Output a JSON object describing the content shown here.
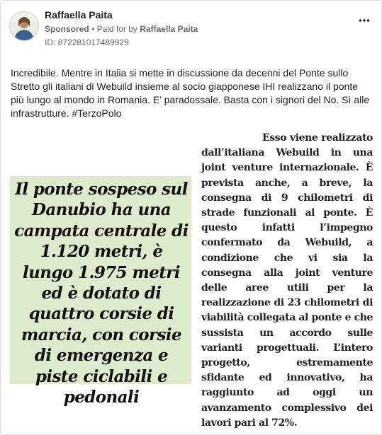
{
  "post": {
    "author": "Raffaella Paita",
    "sponsored_label": "Sponsored",
    "separator": "•",
    "paid_for_prefix": "Paid for by",
    "paid_for_name": "Raffaella Paita",
    "ad_id": "ID: 872281017489929",
    "more_icon": "more-dots-icon",
    "text": "Incredibile. Mentre in Italia si mette in discussione da decenni del Ponte sullo Stretto gli italiani di Webuild insieme al socio giapponese IHI realizzano il ponte più lungo al mondo in Romania. E’ paradossale. Basta con i signori del No. Sì alle infrastrutture. #TerzoPolo"
  },
  "image": {
    "quote": "Il ponte sospeso sul Danubio ha una campata centrale di 1.120 metri, è lungo 1.975 metri ed è dotato di quattro corsie di marcia, con corsie di emergenza e piste ciclabili e pedonali",
    "article": "Esso viene realizzato dall’italiana Webuild in una joint venture internazionale. È prevista anche, a breve, la consegna di 9 chilometri di strade funzionali al ponte. È questo infatti l’impegno confermato da Webuild, a condizione che vi sia la consegna alla joint venture delle aree utili per la realizzazione di 23 chilometri di viabilità collegata al ponte e che sussista un accordo sulle varianti progettuali. L’intero progetto, estremamente sfidante ed innovativo, ha raggiunto ad oggi un avanzamento complessivo dei lavori pari al 72%."
  },
  "colors": {
    "quote_background": "#ddeacc",
    "text_primary": "#1c1e21",
    "text_secondary": "#65676b"
  }
}
